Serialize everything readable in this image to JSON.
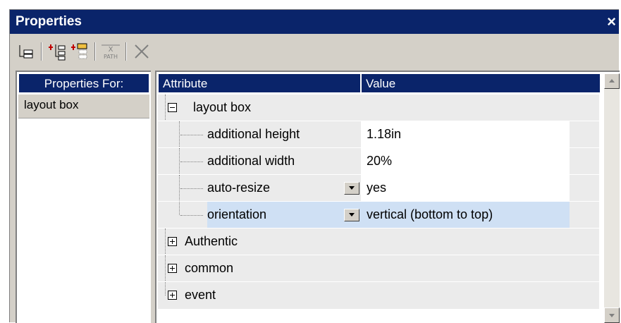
{
  "window": {
    "title": "Properties",
    "close_glyph": "×"
  },
  "toolbar": {
    "buttons": [
      {
        "icon": "tree-view-icon"
      },
      {
        "icon": "add-attribute-icon"
      },
      {
        "icon": "add-child-icon"
      },
      {
        "icon": "xpath-icon",
        "label": "PATH"
      },
      {
        "icon": "delete-icon"
      }
    ]
  },
  "left": {
    "header": "Properties For:",
    "items": [
      "layout box"
    ]
  },
  "grid": {
    "col_attribute": "Attribute",
    "col_value": "Value",
    "group": "layout box",
    "rows": [
      {
        "attr": "additional height",
        "value": "1.18in",
        "dropdown": false
      },
      {
        "attr": "additional width",
        "value": "20%",
        "dropdown": false
      },
      {
        "attr": "auto-resize",
        "value": "yes",
        "dropdown": true
      },
      {
        "attr": "orientation",
        "value": "vertical (bottom to top)",
        "dropdown": true,
        "selected": true
      }
    ],
    "collapsed_groups": [
      "Authentic",
      "common",
      "event"
    ]
  },
  "colors": {
    "title_bg": "#0a246a",
    "selection": "#cfe0f4",
    "face": "#d4d0c8"
  }
}
